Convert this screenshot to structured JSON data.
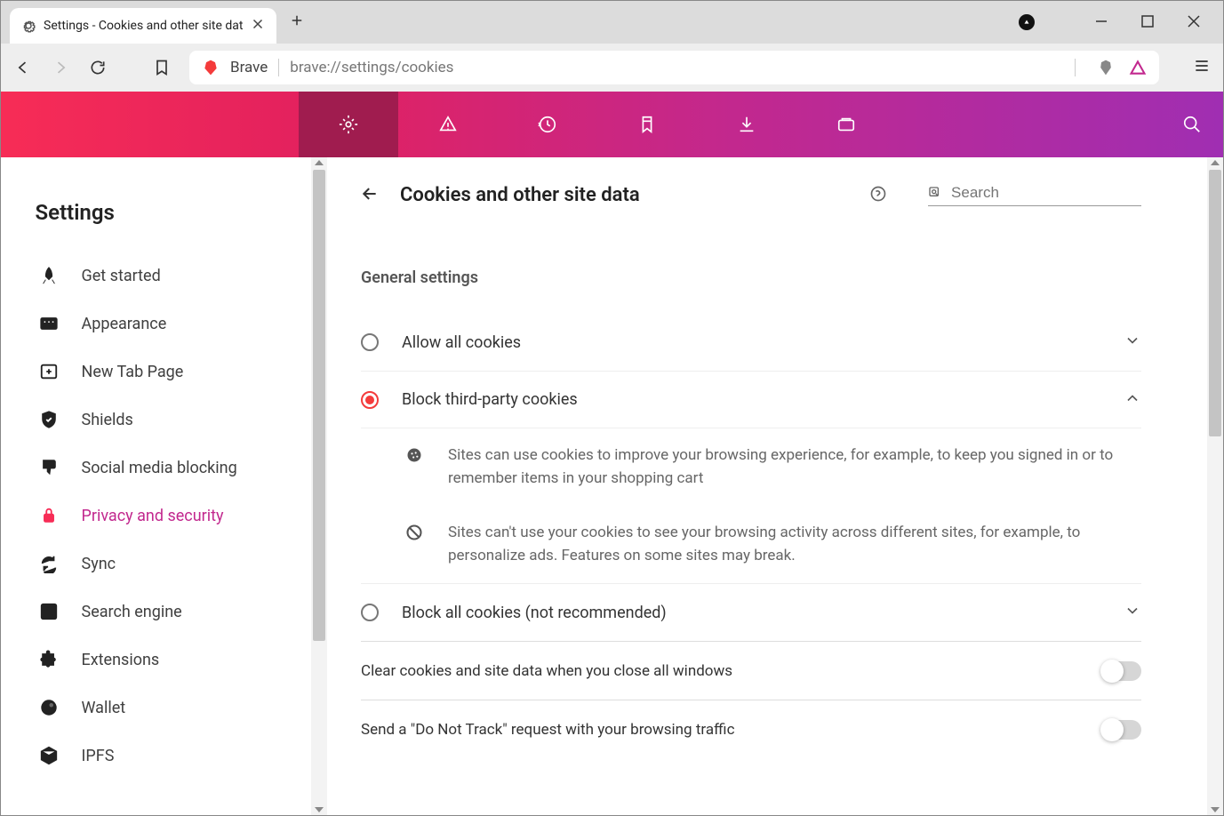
{
  "window": {
    "tab_title": "Settings - Cookies and other site dat"
  },
  "addressbar": {
    "brand": "Brave",
    "url": "brave://settings/cookies"
  },
  "sidebar": {
    "title": "Settings",
    "items": [
      {
        "label": "Get started"
      },
      {
        "label": "Appearance"
      },
      {
        "label": "New Tab Page"
      },
      {
        "label": "Shields"
      },
      {
        "label": "Social media blocking"
      },
      {
        "label": "Privacy and security"
      },
      {
        "label": "Sync"
      },
      {
        "label": "Search engine"
      },
      {
        "label": "Extensions"
      },
      {
        "label": "Wallet"
      },
      {
        "label": "IPFS"
      }
    ]
  },
  "page": {
    "title": "Cookies and other site data",
    "search_placeholder": "Search",
    "section_title": "General settings",
    "options": {
      "allow": "Allow all cookies",
      "block_third": "Block third-party cookies",
      "block_all": "Block all cookies (not recommended)"
    },
    "descriptions": {
      "cookie_use": "Sites can use cookies to improve your browsing experience, for example, to keep you signed in or to remember items in your shopping cart",
      "cookie_block": "Sites can't use your cookies to see your browsing activity across different sites, for example, to personalize ads. Features on some sites may break."
    },
    "toggles": {
      "clear_close": "Clear cookies and site data when you close all windows",
      "dnt": "Send a \"Do Not Track\" request with your browsing traffic"
    }
  }
}
